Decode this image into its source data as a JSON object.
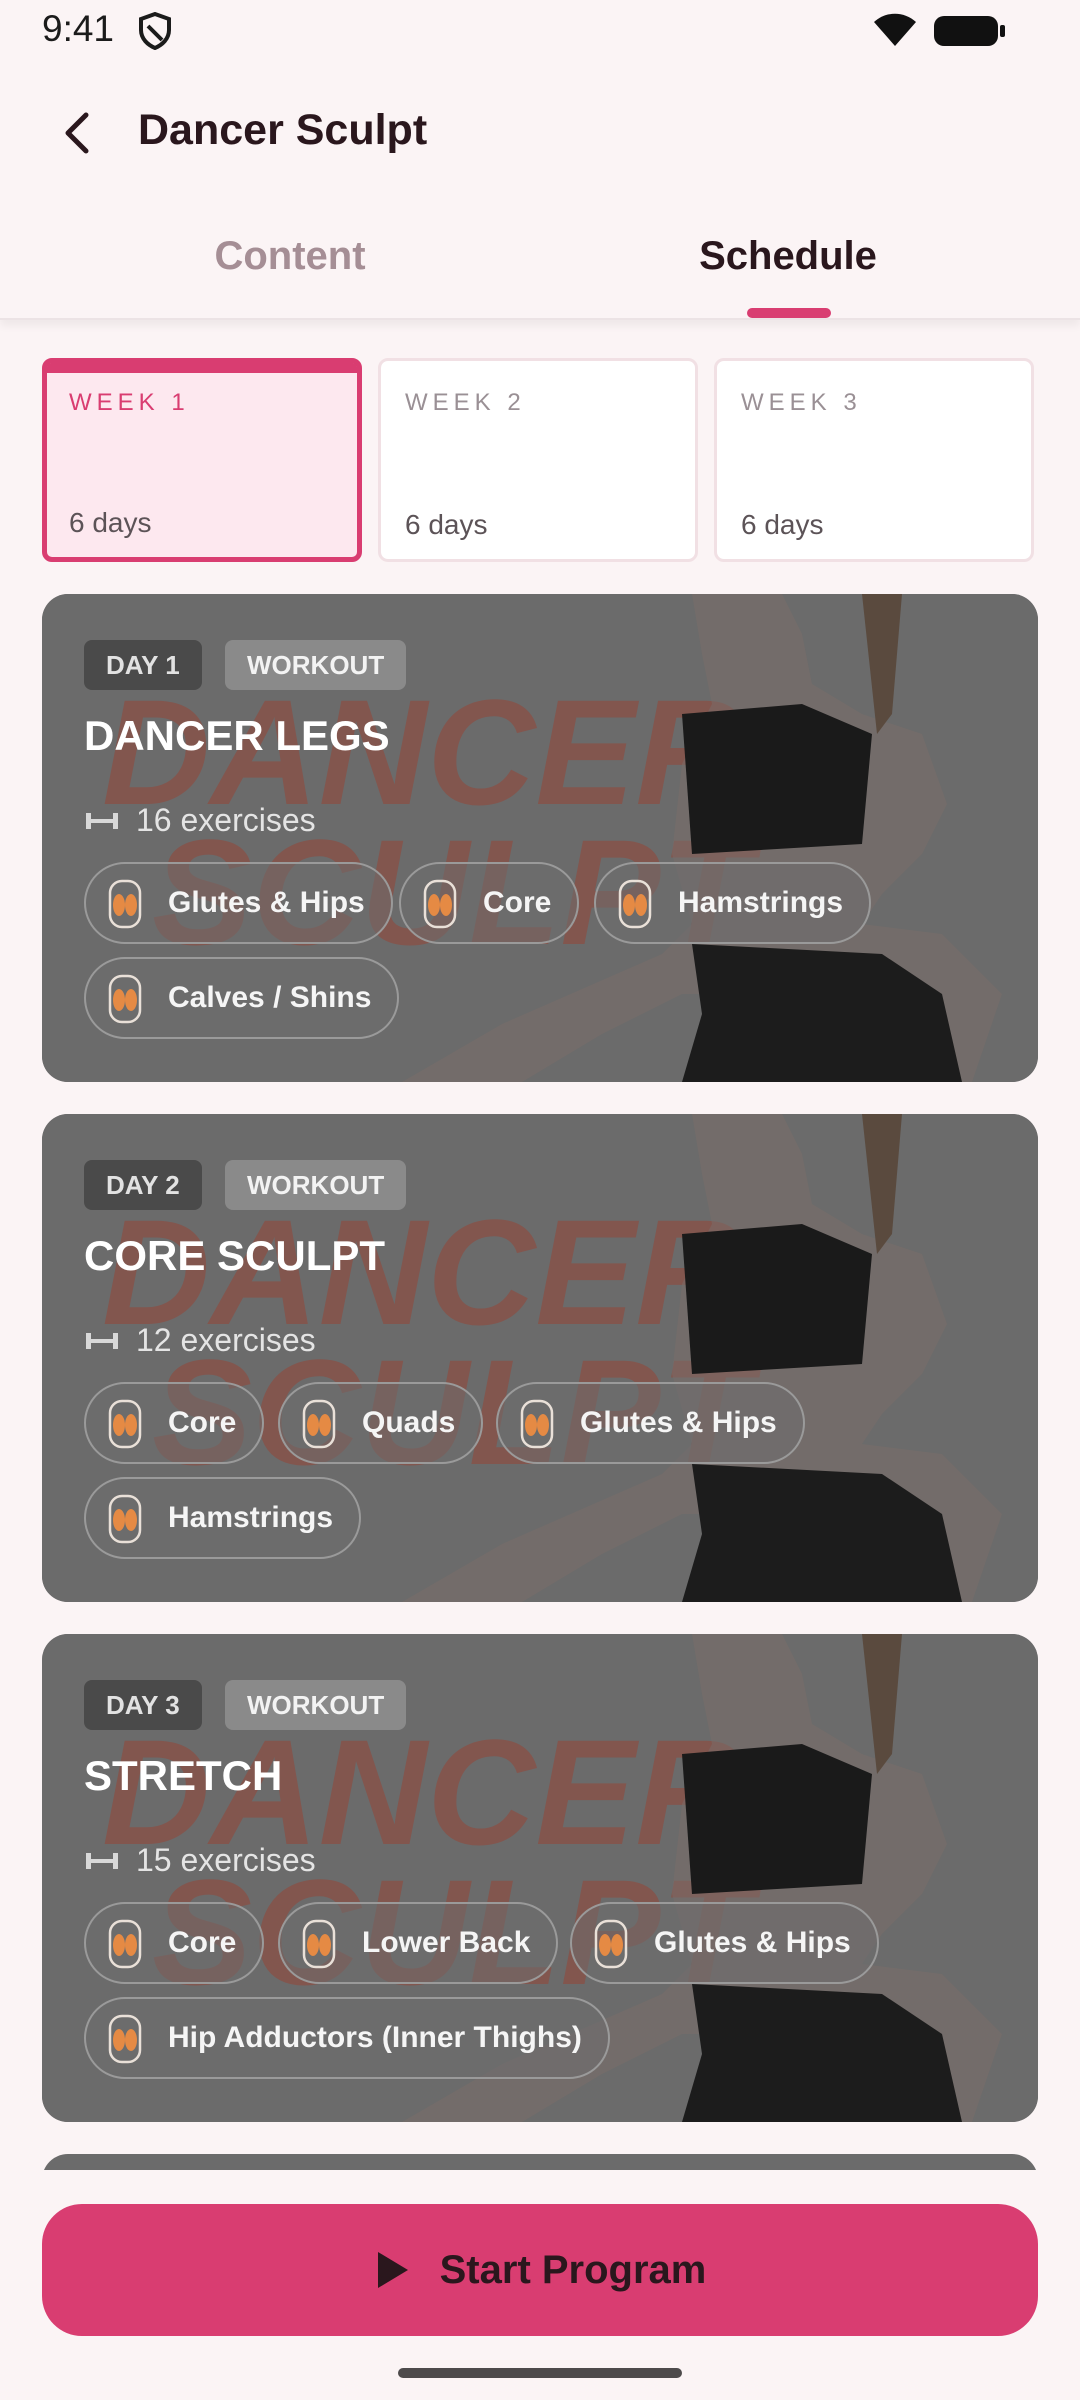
{
  "status_bar": {
    "time": "9:41"
  },
  "header": {
    "title": "Dancer Sculpt"
  },
  "tabs": [
    {
      "label": "Content",
      "active": false
    },
    {
      "label": "Schedule",
      "active": true
    }
  ],
  "weeks": [
    {
      "label": "WEEK 1",
      "days": "6 days",
      "active": true
    },
    {
      "label": "WEEK 2",
      "days": "6 days",
      "active": false
    },
    {
      "label": "WEEK 3",
      "days": "6 days",
      "active": false
    }
  ],
  "days": [
    {
      "day": "DAY 1",
      "type": "WORKOUT",
      "title": "DANCER LEGS",
      "exercises": "16 exercises",
      "muscles": [
        "Glutes & Hips",
        "Core",
        "Hamstrings",
        "Calves / Shins"
      ]
    },
    {
      "day": "DAY 2",
      "type": "WORKOUT",
      "title": "CORE SCULPT",
      "exercises": "12 exercises",
      "muscles": [
        "Core",
        "Quads",
        "Glutes & Hips",
        "Hamstrings"
      ]
    },
    {
      "day": "DAY 3",
      "type": "WORKOUT",
      "title": "STRETCH",
      "exercises": "15 exercises",
      "muscles": [
        "Core",
        "Lower Back",
        "Glutes & Hips",
        "Hip Adductors (Inner Thighs)"
      ]
    }
  ],
  "card_background": {
    "watermark_line1": "DANCER",
    "watermark_line2": "SCULPT"
  },
  "cta": {
    "label": "Start Program"
  },
  "colors": {
    "accent": "#d93d71",
    "background": "#fbf4f5",
    "card": "#6b6b6b"
  }
}
